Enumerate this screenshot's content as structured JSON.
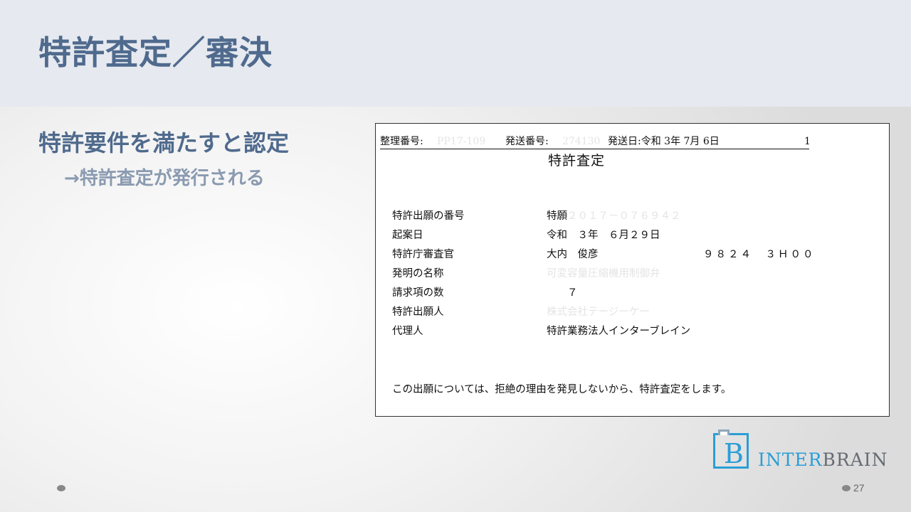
{
  "slide": {
    "title": "特許査定／審決",
    "main_point": "特許要件を満たすと認定",
    "sub_point": "→特許査定が発行される",
    "page_number": "27"
  },
  "document": {
    "header": {
      "ref_label": "整理番号:",
      "ref_value": "PP17-109",
      "send_no_label": "発送番号:",
      "send_no_value": "274130",
      "send_date": "発送日:令和 3年 7月 6日",
      "page": "1"
    },
    "title": "特許査定",
    "rows": [
      {
        "label": "特許出願の番号",
        "value": "特願",
        "value_redacted": "２０１７－０７６９４２",
        "extra": ""
      },
      {
        "label": "起案日",
        "value": "令和　３年　６月２９日",
        "value_redacted": "",
        "extra": ""
      },
      {
        "label": "特許庁審査官",
        "value": "大内　俊彦",
        "value_redacted": "",
        "extra": "９８２４　３Ｈ００"
      },
      {
        "label": "発明の名称",
        "value": "",
        "value_redacted": "可変容量圧縮機用制御弁",
        "extra": ""
      },
      {
        "label": "請求項の数",
        "value": "　　７",
        "value_redacted": "",
        "extra": ""
      },
      {
        "label": "特許出願人",
        "value": "",
        "value_redacted": "株式会社テージーケー",
        "extra": ""
      },
      {
        "label": "代理人",
        "value": "特許業務法人インターブレイン",
        "value_redacted": "",
        "extra": ""
      }
    ],
    "footer": "この出願については、拒絶の理由を発見しないから、特許査定をします。"
  },
  "logo": {
    "letter": "B",
    "text_inter": "INTER",
    "text_brain": "BRAIN",
    "color_primary": "#2a9ed6",
    "color_secondary": "#666b74"
  },
  "colors": {
    "title": "#4f6a8d",
    "sub_point": "#8a9ab0",
    "header_band": "#e6e9ef"
  }
}
